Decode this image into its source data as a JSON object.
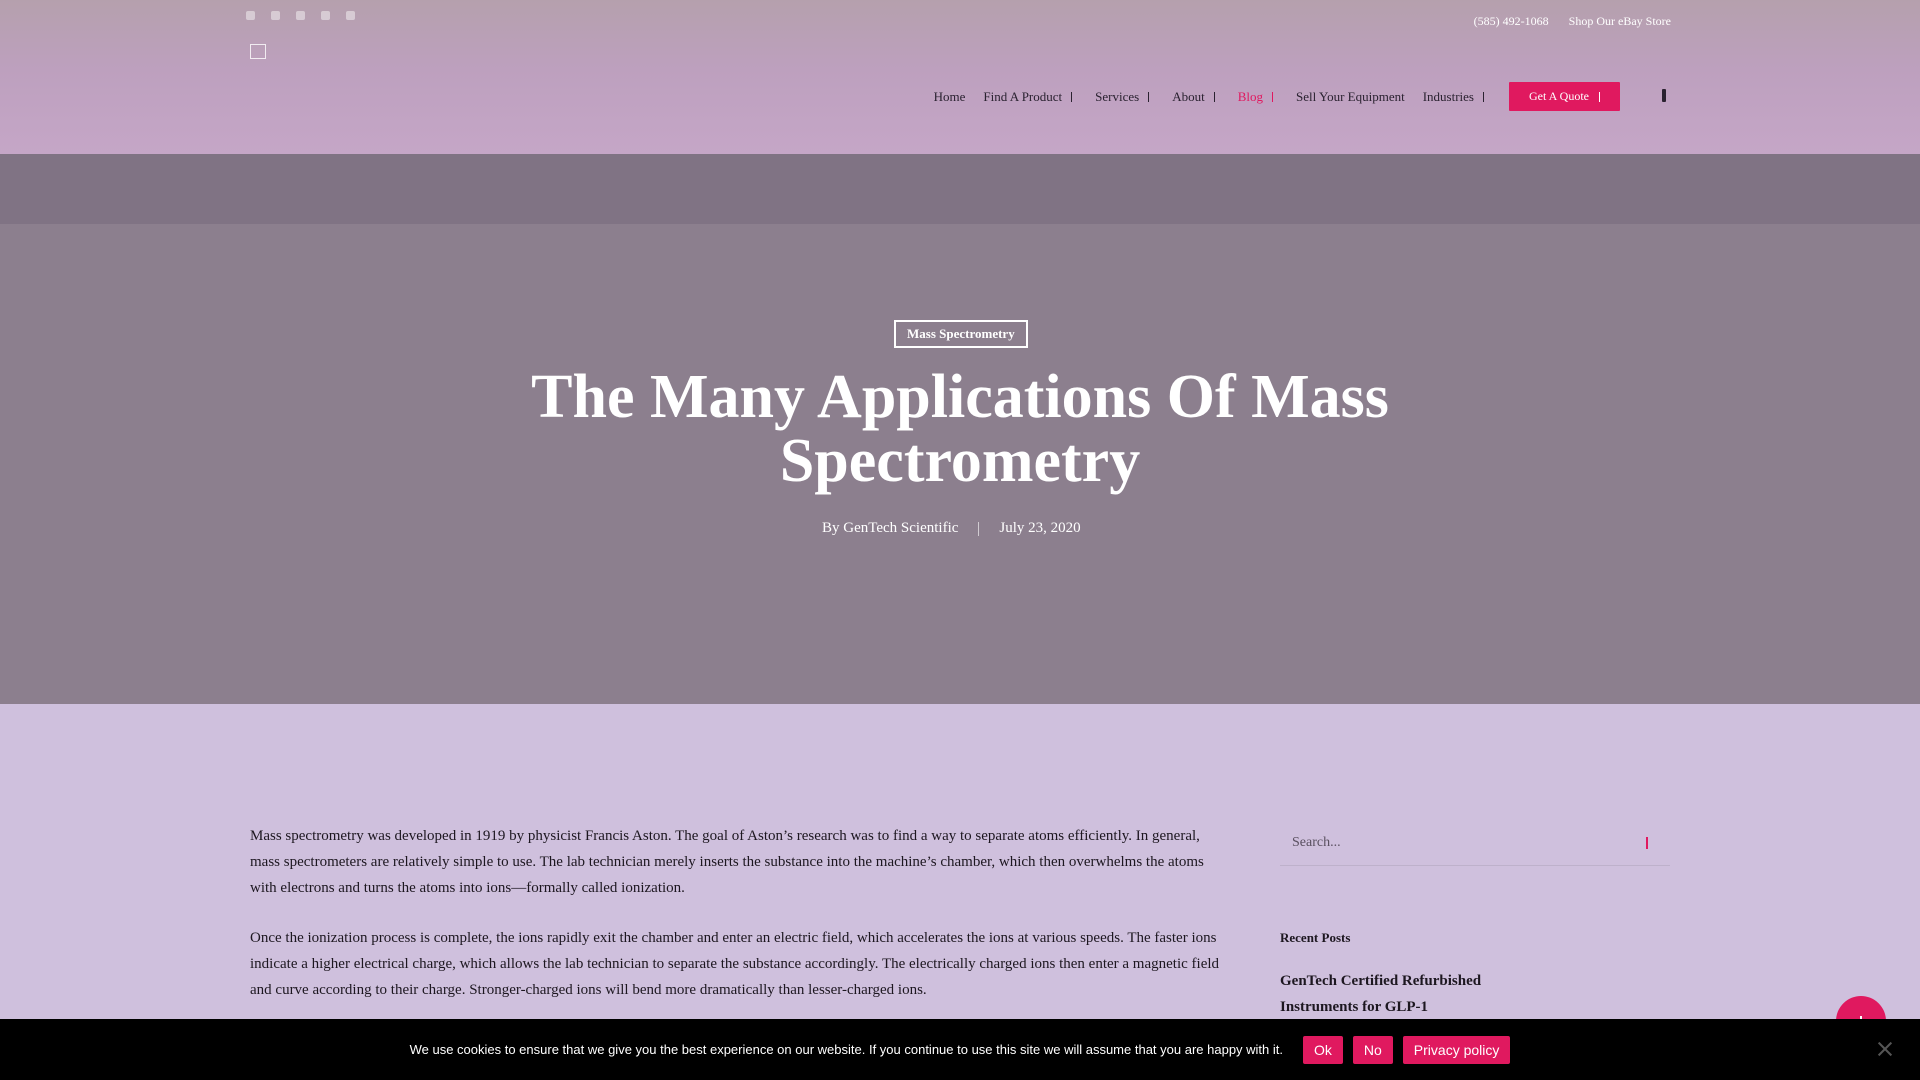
{
  "topbar": {
    "social_icons": [
      "facebook-icon",
      "twitter-icon",
      "linkedin-icon",
      "youtube-icon",
      "instagram-icon"
    ],
    "phone": "(585) 492-1068",
    "ebay_link": "Shop Our eBay Store"
  },
  "nav": {
    "items": [
      {
        "label": "Home",
        "has_dropdown": false
      },
      {
        "label": "Find A Product",
        "has_dropdown": true
      },
      {
        "label": "Services",
        "has_dropdown": true
      },
      {
        "label": "About",
        "has_dropdown": true
      },
      {
        "label": "Blog",
        "has_dropdown": true,
        "active": true
      },
      {
        "label": "Sell Your Equipment",
        "has_dropdown": false
      },
      {
        "label": "Industries",
        "has_dropdown": true
      }
    ],
    "cta_label": "Get A Quote"
  },
  "hero": {
    "category": "Mass Spectrometry",
    "title": "The Many Applications Of Mass Spectrometry",
    "author": "By GenTech Scientific",
    "date": "July 23, 2020"
  },
  "article": {
    "paragraphs": [
      "Mass spectrometry was developed in 1919 by physicist Francis Aston. The goal of Aston’s research was to find a way to separate atoms efficiently. In general, mass spectrometers are relatively simple to use. The lab technician merely inserts the substance into the machine’s chamber, which then overwhelms the atoms with electrons and turns the atoms into ions—formally called ionization.",
      "Once the ionization process is complete, the ions rapidly exit the chamber and enter an electric field, which accelerates the ions at various speeds. The faster ions indicate a higher electrical charge, which allows the lab technician to separate the substance accordingly. The electrically charged ions then enter a magnetic field and curve according to their charge. Stronger-charged ions will bend more dramatically than lesser-charged ions."
    ]
  },
  "sidebar": {
    "search_placeholder": "Search...",
    "recent_title": "Recent Posts",
    "recent_posts": [
      "GenTech Certified Refurbished Instruments for GLP-1"
    ]
  },
  "cookie": {
    "message": "We use cookies to ensure that we give you the best experience on our website. If you continue to use this site we will assume that you are happy with it.",
    "ok_label": "Ok",
    "no_label": "No",
    "privacy_label": "Privacy policy"
  },
  "colors": {
    "accent": "#e0195f",
    "hero_bg": "#8c7f8e",
    "body_bg": "#cfc0dd"
  }
}
